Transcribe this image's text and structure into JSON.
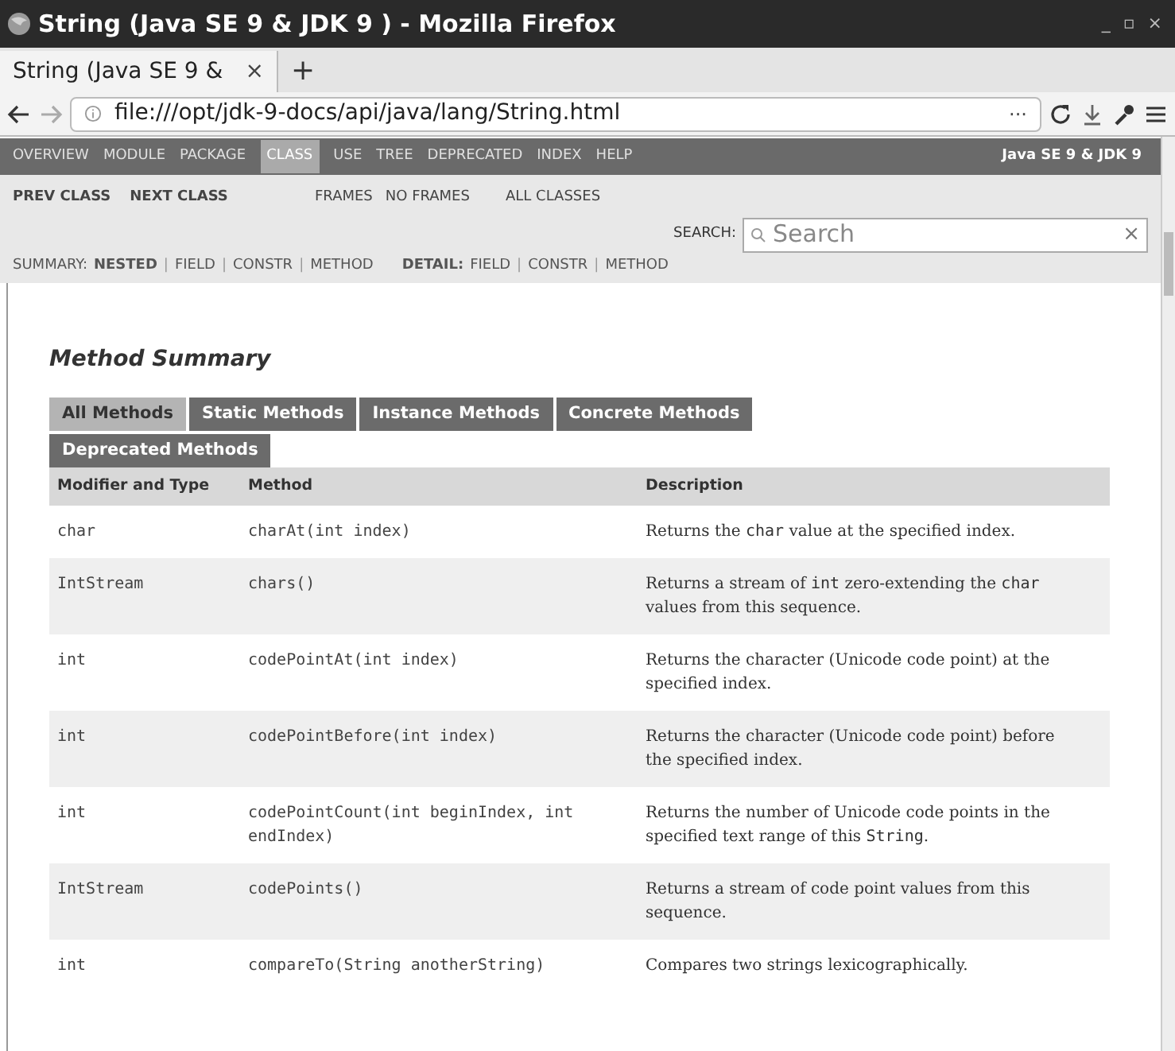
{
  "window": {
    "title": "String (Java SE 9 & JDK 9 ) - Mozilla Firefox",
    "controls": [
      "_",
      "▫",
      "×"
    ]
  },
  "browser_tab": {
    "label": "String (Java SE 9 &",
    "close": "×",
    "new_tab": "+"
  },
  "address_bar": {
    "url": "file:///opt/jdk-9-docs/api/java/lang/String.html",
    "more": "···"
  },
  "top_nav": {
    "items": [
      {
        "label": "OVERVIEW",
        "selected": false
      },
      {
        "label": "MODULE",
        "selected": false
      },
      {
        "label": "PACKAGE",
        "selected": false
      },
      {
        "label": "CLASS",
        "selected": true
      },
      {
        "label": "USE",
        "selected": false
      },
      {
        "label": "TREE",
        "selected": false
      },
      {
        "label": "DEPRECATED",
        "selected": false
      },
      {
        "label": "INDEX",
        "selected": false
      },
      {
        "label": "HELP",
        "selected": false
      }
    ],
    "product": "Java SE 9 & JDK 9"
  },
  "sub_nav": {
    "class_links": [
      "PREV CLASS",
      "NEXT CLASS"
    ],
    "frame_links": [
      "FRAMES",
      "NO FRAMES"
    ],
    "all_classes": "ALL CLASSES"
  },
  "search": {
    "label": "SEARCH:",
    "placeholder": "Search",
    "clear": "×"
  },
  "summary_nav": {
    "separator": "|",
    "summary_label": "SUMMARY:",
    "summary_links": [
      "NESTED",
      "FIELD",
      "CONSTR",
      "METHOD"
    ],
    "detail_label": "DETAIL:",
    "detail_links": [
      "FIELD",
      "CONSTR",
      "METHOD"
    ]
  },
  "method_summary": {
    "title": "Method Summary",
    "tabs": [
      {
        "label": "All Methods",
        "selected": true
      },
      {
        "label": "Static Methods",
        "selected": false
      },
      {
        "label": "Instance Methods",
        "selected": false
      },
      {
        "label": "Concrete Methods",
        "selected": false
      },
      {
        "label": "Deprecated Methods",
        "selected": false
      }
    ],
    "columns": [
      "Modifier and Type",
      "Method",
      "Description"
    ],
    "rows": [
      {
        "type": "char",
        "method": "charAt(int index)",
        "description": [
          {
            "kind": "text",
            "text": "Returns the "
          },
          {
            "kind": "code",
            "text": "char"
          },
          {
            "kind": "text",
            "text": " value at the specified index."
          }
        ]
      },
      {
        "type": "IntStream",
        "method": "chars()",
        "description": [
          {
            "kind": "text",
            "text": "Returns a stream of "
          },
          {
            "kind": "code",
            "text": "int"
          },
          {
            "kind": "text",
            "text": " zero-extending the "
          },
          {
            "kind": "code",
            "text": "char"
          },
          {
            "kind": "text",
            "text": " values from this sequence."
          }
        ]
      },
      {
        "type": "int",
        "method": "codePointAt(int index)",
        "description": [
          {
            "kind": "text",
            "text": "Returns the character (Unicode code point) at the specified index."
          }
        ]
      },
      {
        "type": "int",
        "method": "codePointBefore(int index)",
        "description": [
          {
            "kind": "text",
            "text": "Returns the character (Unicode code point) before the specified index."
          }
        ]
      },
      {
        "type": "int",
        "method": "codePointCount(int beginIndex, int endIndex)",
        "description": [
          {
            "kind": "text",
            "text": "Returns the number of Unicode code points in the specified text range of this "
          },
          {
            "kind": "code",
            "text": "String"
          },
          {
            "kind": "text",
            "text": "."
          }
        ]
      },
      {
        "type": "IntStream",
        "method": "codePoints()",
        "description": [
          {
            "kind": "text",
            "text": "Returns a stream of code point values from this sequence."
          }
        ]
      },
      {
        "type": "int",
        "method": "compareTo(String anotherString)",
        "description": [
          {
            "kind": "text",
            "text": "Compares two strings lexicographically."
          }
        ]
      }
    ]
  }
}
